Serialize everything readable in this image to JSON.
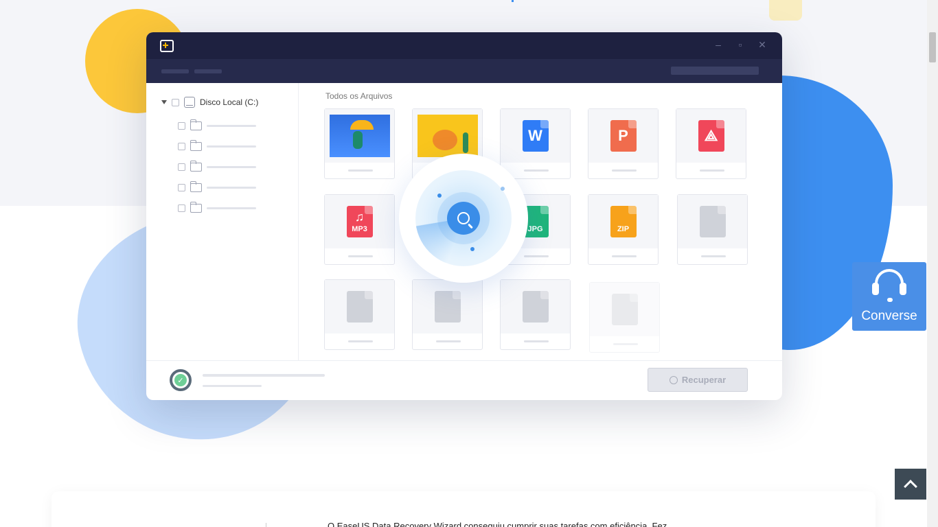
{
  "app": {
    "sidebar": {
      "root_label": "Disco Local (C:)"
    },
    "main": {
      "title": "Todos os Arquivos",
      "files": [
        {
          "type": "image",
          "label": ""
        },
        {
          "type": "image",
          "label": ""
        },
        {
          "type": "doc",
          "label": "W",
          "color": "#2f7cf6"
        },
        {
          "type": "ppt",
          "label": "P",
          "color": "#f06c4d"
        },
        {
          "type": "pdf",
          "label": "pdf",
          "color": "#f0475a"
        },
        {
          "type": "mp3",
          "label": "MP3",
          "color": "#f0475a"
        },
        {
          "type": "jpg",
          "label": "JPG",
          "color": "#1fb57b"
        },
        {
          "type": "zip",
          "label": "ZIP",
          "color": "#f7a21b"
        }
      ]
    },
    "footer": {
      "recover_button": "Recuperar"
    }
  },
  "chat_widget": {
    "label": "Converse"
  },
  "review": {
    "text": "O EaseUS Data Recovery Wizard conseguiu cumprir suas tarefas com eficiência. Fez"
  },
  "colors": {
    "accent": "#3d8ff0",
    "chat": "#4a8fe7",
    "titlebar": "#1e2140"
  }
}
